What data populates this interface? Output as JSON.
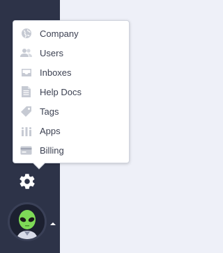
{
  "colors": {
    "sidebar_bg": "#2d3348",
    "main_bg": "#eef0f8",
    "menu_text": "#3c4152",
    "menu_icon": "#c6cad3",
    "avatar_accent": "#7ed957"
  },
  "menu": {
    "items": [
      {
        "label": "Company",
        "icon": "globe-icon"
      },
      {
        "label": "Users",
        "icon": "users-icon"
      },
      {
        "label": "Inboxes",
        "icon": "inbox-icon"
      },
      {
        "label": "Help Docs",
        "icon": "document-icon"
      },
      {
        "label": "Tags",
        "icon": "tag-icon"
      },
      {
        "label": "Apps",
        "icon": "apps-icon"
      },
      {
        "label": "Billing",
        "icon": "credit-card-icon"
      }
    ]
  },
  "sidebar": {
    "settings_icon": "gear-icon",
    "avatar_icon": "alien-avatar-icon"
  }
}
